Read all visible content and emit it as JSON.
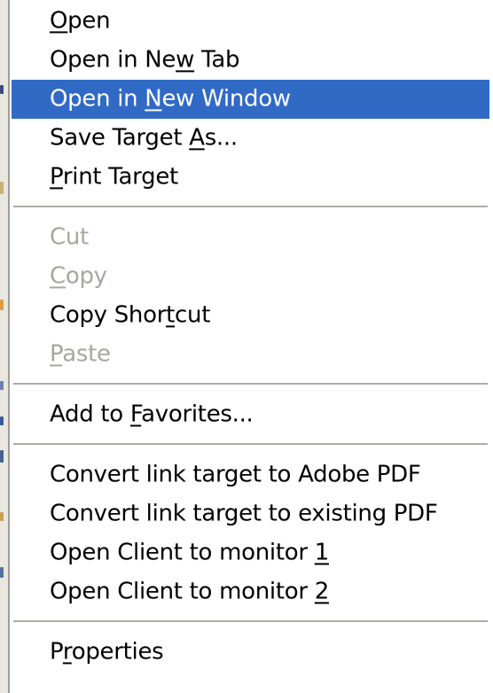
{
  "context_menu": {
    "groups": [
      [
        {
          "before": "",
          "key": "O",
          "after": "pen",
          "state": "normal"
        },
        {
          "before": "Open in Ne",
          "key": "w",
          "after": " Tab",
          "state": "normal"
        },
        {
          "before": "Open in ",
          "key": "N",
          "after": "ew Window",
          "state": "highlighted"
        },
        {
          "before": "Save Target ",
          "key": "A",
          "after": "s...",
          "state": "normal"
        },
        {
          "before": "",
          "key": "P",
          "after": "rint Target",
          "state": "normal"
        }
      ],
      [
        {
          "before": "Cut",
          "key": "",
          "after": "",
          "state": "disabled"
        },
        {
          "before": "",
          "key": "C",
          "after": "opy",
          "state": "disabled"
        },
        {
          "before": "Copy Shor",
          "key": "t",
          "after": "cut",
          "state": "normal"
        },
        {
          "before": "",
          "key": "P",
          "after": "aste",
          "state": "disabled"
        }
      ],
      [
        {
          "before": "Add to ",
          "key": "F",
          "after": "avorites...",
          "state": "normal"
        }
      ],
      [
        {
          "before": "Convert link target to Adobe PDF",
          "key": "",
          "after": "",
          "state": "normal"
        },
        {
          "before": "Convert link target to existing PDF",
          "key": "",
          "after": "",
          "state": "normal"
        },
        {
          "before": "Open Client to monitor ",
          "key": "1",
          "after": "",
          "state": "normal"
        },
        {
          "before": "Open Client to monitor ",
          "key": "2",
          "after": "",
          "state": "normal"
        }
      ],
      [
        {
          "before": "P",
          "key": "r",
          "after": "operties",
          "state": "normal"
        }
      ]
    ],
    "colors": {
      "highlight_bg": "#316ac5",
      "highlight_text": "#ffffff",
      "text": "#000000",
      "disabled_text": "#a8a69e",
      "menu_bg": "#ffffff",
      "separator": "#acaca6"
    }
  }
}
